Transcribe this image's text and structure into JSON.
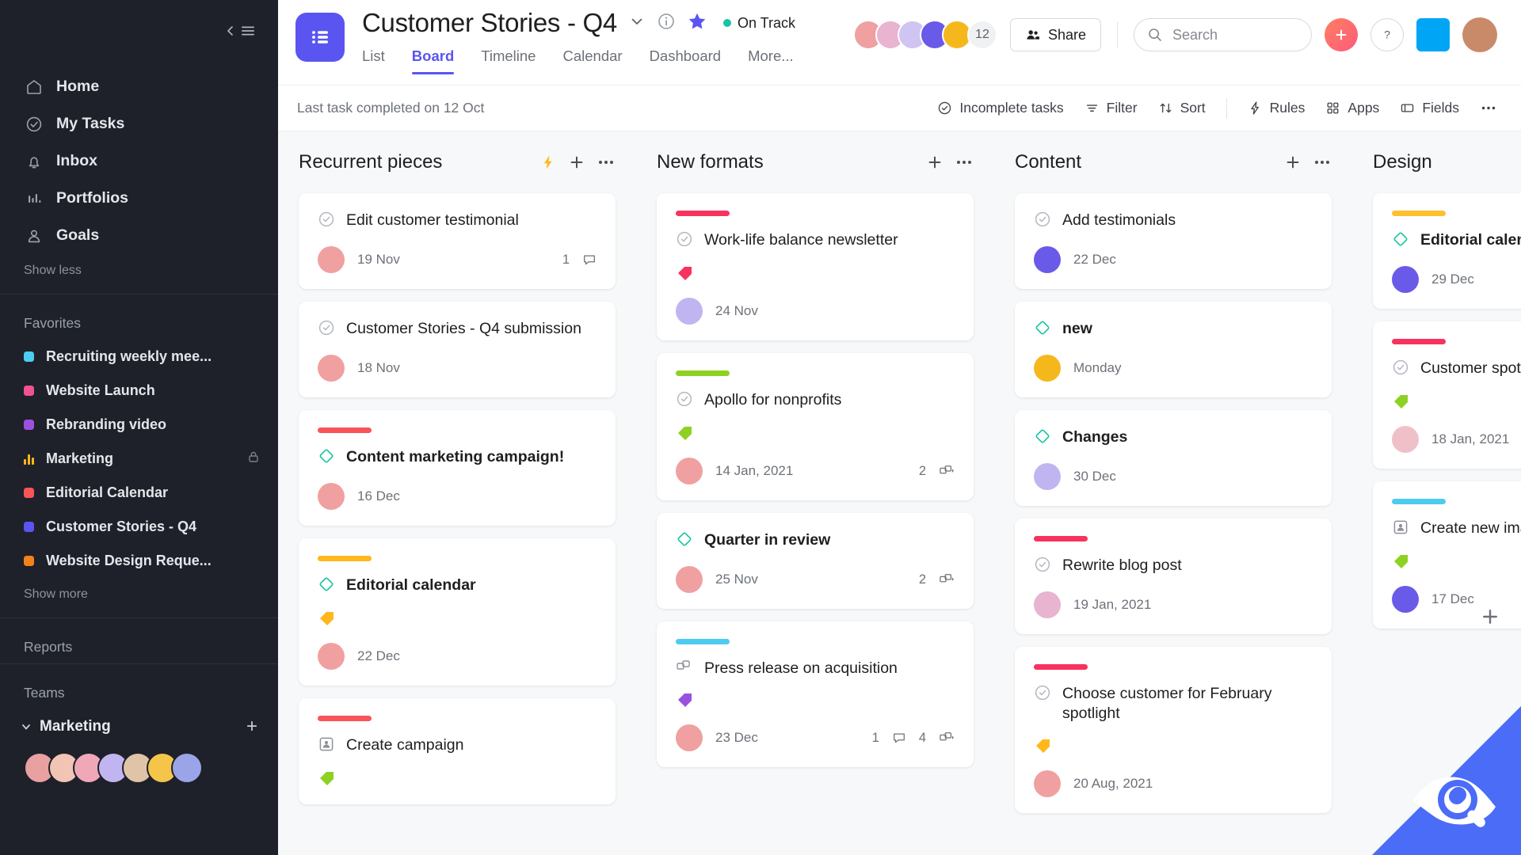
{
  "sidebar": {
    "collapse_label": "collapse-sidebar",
    "nav": [
      {
        "label": "Home",
        "icon": "home-icon"
      },
      {
        "label": "My Tasks",
        "icon": "check-circle-icon"
      },
      {
        "label": "Inbox",
        "icon": "bell-icon"
      },
      {
        "label": "Portfolios",
        "icon": "bar-chart-icon"
      },
      {
        "label": "Goals",
        "icon": "goal-person-icon"
      }
    ],
    "show_less": "Show less",
    "favorites_title": "Favorites",
    "favorites": [
      {
        "label": "Recruiting weekly mee...",
        "color": "#4ecbf0",
        "icon": "dot",
        "locked": false
      },
      {
        "label": "Website Launch",
        "color": "#f2528f",
        "icon": "dot",
        "locked": false
      },
      {
        "label": "Rebranding video",
        "color": "#9b51e0",
        "icon": "dot",
        "locked": false
      },
      {
        "label": "Marketing",
        "color": "#ffb71c",
        "icon": "bars",
        "locked": true
      },
      {
        "label": "Editorial Calendar",
        "color": "#f8545a",
        "icon": "dot",
        "locked": false
      },
      {
        "label": "Customer Stories - Q4",
        "color": "#5a55f0",
        "icon": "dot",
        "locked": false
      },
      {
        "label": "Website Design Reque...",
        "color": "#f2821c",
        "icon": "dot",
        "locked": false
      }
    ],
    "show_more": "Show more",
    "reports_title": "Reports",
    "teams_title": "Teams",
    "team_name": "Marketing",
    "team_add": "+",
    "team_avatars": [
      "#e8a0a0",
      "#f2c4b3",
      "#f0a8b8",
      "#c0b5f0",
      "#e0c4a8",
      "#f5c54a",
      "#9aa4e8"
    ]
  },
  "header": {
    "project_icon": "board-list-icon",
    "title": "Customer Stories - Q4",
    "dropdown_icon": "chevron-down-icon",
    "info_icon": "info-icon",
    "star_icon": "star-icon",
    "status": "On Track",
    "status_color": "#14c4a2",
    "tabs": [
      {
        "label": "List",
        "active": false
      },
      {
        "label": "Board",
        "active": true
      },
      {
        "label": "Timeline",
        "active": false
      },
      {
        "label": "Calendar",
        "active": false
      },
      {
        "label": "Dashboard",
        "active": false
      },
      {
        "label": "More...",
        "active": false
      }
    ],
    "member_count": "12",
    "member_avatars": [
      "#f0a0a0",
      "#e8b4d0",
      "#cfc4f2",
      "#6a5ae8",
      "#f5b81c"
    ],
    "share_label": "Share",
    "share_icon": "people-icon",
    "search_placeholder": "Search",
    "search_icon": "search-icon",
    "plus_icon": "plus-icon",
    "help_icon": "question-icon",
    "app_square_color": "#00a5f5",
    "profile_avatar": "#c98a6a"
  },
  "toolbar": {
    "last_task": "Last task completed on 12 Oct",
    "items": [
      {
        "label": "Incomplete tasks",
        "icon": "check-circle-icon"
      },
      {
        "label": "Filter",
        "icon": "filter-icon"
      },
      {
        "label": "Sort",
        "icon": "sort-icon"
      },
      {
        "label": "Rules",
        "icon": "bolt-icon"
      },
      {
        "label": "Apps",
        "icon": "apps-icon"
      },
      {
        "label": "Fields",
        "icon": "fields-icon"
      }
    ],
    "more_icon": "ellipsis-icon"
  },
  "board": {
    "add_column_icon": "plus-icon",
    "columns": [
      {
        "title": "Recurrent pieces",
        "has_bolt": true,
        "bolt_icon": "bolt-icon",
        "add_icon": "plus-icon",
        "menu_icon": "ellipsis-icon",
        "cards": [
          {
            "bar_color": null,
            "status_icon": "check-circle-icon",
            "title": "Edit customer testimonial",
            "bold": false,
            "avatar": "#f0a0a0",
            "date": "19 Nov",
            "tag_color": null,
            "comments": "1",
            "subtasks": null
          },
          {
            "bar_color": null,
            "status_icon": "check-circle-icon",
            "title": "Customer Stories - Q4 submission",
            "bold": false,
            "avatar": "#f0a0a0",
            "date": "18 Nov",
            "tag_color": null,
            "comments": null,
            "subtasks": null
          },
          {
            "bar_color": "#f8545a",
            "status_icon": "diamond-icon",
            "title": "Content marketing campaign!",
            "bold": true,
            "avatar": "#f0a0a0",
            "date": "16 Dec",
            "tag_color": null,
            "comments": null,
            "subtasks": null
          },
          {
            "bar_color": "#ffb71c",
            "status_icon": "diamond-icon",
            "title": "Editorial calendar",
            "bold": true,
            "avatar": "#f0a0a0",
            "date": "22 Dec",
            "tag_color": "#ffb71c",
            "comments": null,
            "subtasks": null
          },
          {
            "bar_color": "#f8545a",
            "status_icon": "approval-icon",
            "title": "Create campaign",
            "bold": false,
            "avatar": "#f0a0a0",
            "date": "",
            "tag_color": "#8ed122",
            "comments": null,
            "subtasks": null
          }
        ]
      },
      {
        "title": "New formats",
        "has_bolt": false,
        "bolt_icon": null,
        "add_icon": "plus-icon",
        "menu_icon": "ellipsis-icon",
        "cards": [
          {
            "bar_color": "#f8325f",
            "status_icon": "check-circle-icon",
            "title": "Work-life balance newsletter",
            "bold": false,
            "avatar": "#c0b5f0",
            "date": "24 Nov",
            "tag_color": "#f8325f",
            "comments": null,
            "subtasks": null
          },
          {
            "bar_color": "#8ed122",
            "status_icon": "check-circle-icon",
            "title": "Apollo for nonprofits",
            "bold": false,
            "avatar": "#f0a0a0",
            "date": "14 Jan, 2021",
            "tag_color": "#8ed122",
            "comments": null,
            "subtasks": "2"
          },
          {
            "bar_color": null,
            "status_icon": "diamond-icon",
            "title": "Quarter in review",
            "bold": true,
            "avatar": "#f0a0a0",
            "date": "25 Nov",
            "tag_color": null,
            "comments": null,
            "subtasks": "2"
          },
          {
            "bar_color": "#4ecbf0",
            "status_icon": "approval-icon",
            "title": "Press release on acquisition",
            "bold": false,
            "avatar": "#f0a0a0",
            "date": "23 Dec",
            "tag_color": "#9b51e0",
            "comments": "1",
            "subtasks": "4"
          }
        ]
      },
      {
        "title": "Content",
        "has_bolt": false,
        "bolt_icon": null,
        "add_icon": "plus-icon",
        "menu_icon": "ellipsis-icon",
        "cards": [
          {
            "bar_color": null,
            "status_icon": "check-circle-icon",
            "title": "Add testimonials",
            "bold": false,
            "avatar": "#6a5ae8",
            "date": "22 Dec",
            "tag_color": null,
            "comments": null,
            "subtasks": null
          },
          {
            "bar_color": null,
            "status_icon": "diamond-icon",
            "title": "new",
            "bold": true,
            "avatar": "#f5b81c",
            "date": "Monday",
            "tag_color": null,
            "comments": null,
            "subtasks": null
          },
          {
            "bar_color": null,
            "status_icon": "diamond-icon",
            "title": "Changes",
            "bold": true,
            "avatar": "#c0b5f0",
            "date": "30 Dec",
            "tag_color": null,
            "comments": null,
            "subtasks": null
          },
          {
            "bar_color": "#f8325f",
            "status_icon": "check-circle-icon",
            "title": "Rewrite blog post",
            "bold": false,
            "avatar": "#e8b4d0",
            "date": "19 Jan, 2021",
            "tag_color": null,
            "comments": null,
            "subtasks": null
          },
          {
            "bar_color": "#f8325f",
            "status_icon": "check-circle-icon",
            "title": "Choose customer for February spotlight",
            "bold": false,
            "avatar": "#f0a0a0",
            "date": "20 Aug, 2021",
            "tag_color": "#ffb71c",
            "comments": null,
            "subtasks": null
          }
        ]
      },
      {
        "title": "Design",
        "has_bolt": false,
        "bolt_icon": null,
        "add_icon": null,
        "menu_icon": null,
        "cards": [
          {
            "bar_color": "#ffc02e",
            "status_icon": "diamond-icon",
            "title": "Editorial calendar",
            "bold": true,
            "avatar": "#6a5ae8",
            "date": "29 Dec",
            "tag_color": null,
            "comments": null,
            "subtasks": null
          },
          {
            "bar_color": "#f8325f",
            "status_icon": "check-circle-icon",
            "title": "Customer spotlight",
            "bold": false,
            "avatar": "#f0c0c8",
            "date": "18 Jan, 2021",
            "tag_color": "#8ed122",
            "comments": null,
            "subtasks": null
          },
          {
            "bar_color": "#4ecbf0",
            "status_icon": "approval-icon",
            "title": "Create new image",
            "bold": false,
            "avatar": "#6a5ae8",
            "date": "17 Dec",
            "tag_color": "#8ed122",
            "comments": null,
            "subtasks": null
          }
        ]
      }
    ]
  },
  "overlay": {
    "corner_color": "#4a6cf7",
    "icon": "eye-search-icon"
  }
}
